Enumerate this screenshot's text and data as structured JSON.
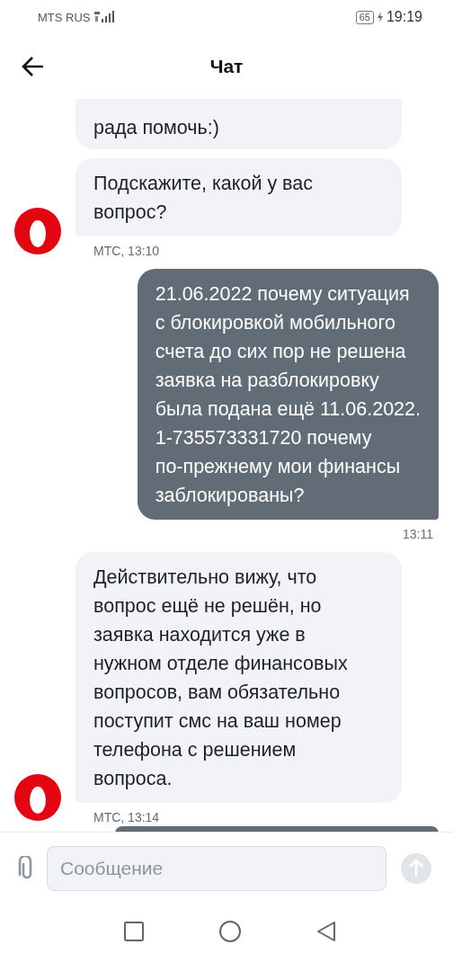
{
  "status_bar": {
    "carrier": "MTS RUS",
    "battery": "65",
    "time": "19:19"
  },
  "header": {
    "title": "Чат"
  },
  "messages": [
    {
      "kind": "incoming",
      "bubbles": [
        {
          "text": "рада помочь:)",
          "cut_top": true
        },
        {
          "text": "Подскажите, какой у вас\nвопрос?",
          "cut_top": false
        }
      ],
      "meta": "МТС, 13:10"
    },
    {
      "kind": "outgoing",
      "bubbles": [
        {
          "text": "21.06.2022 почему ситуация\nс блокировкой мобильного\nсчета до сих пор не решена\nзаявка на разблокировку\nбыла подана ещё 11.06.2022.\n1-735573331720 почему\nпо-прежнему мои финансы\nзаблокированы?",
          "cut_top": false
        }
      ],
      "meta": "13:11"
    },
    {
      "kind": "incoming",
      "bubbles": [
        {
          "text": "Действительно вижу, что\nвопрос ещё не решён, но\nзаявка находится уже в\nнужном отделе финансовых\nвопросов, вам обязательно\nпоступит смс на ваш номер\nтелефона с решением\nвопроса.",
          "cut_top": false
        }
      ],
      "meta": "МТС, 13:14"
    },
    {
      "kind": "outgoing_cut"
    }
  ],
  "composer": {
    "placeholder": "Сообщение"
  }
}
